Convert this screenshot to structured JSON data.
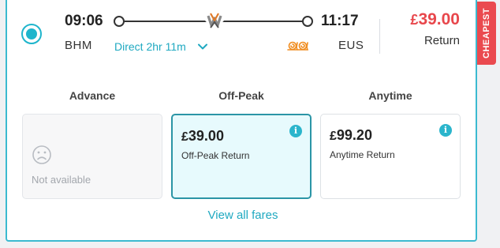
{
  "journey": {
    "departure_time": "09:06",
    "arrival_time": "11:17",
    "origin": "BHM",
    "destination": "EUS",
    "journey_type": "Direct 2hr 11m",
    "price_symbol": "£",
    "price_amount": "39.00",
    "ticket_type": "Return",
    "badge": "CHEAPEST",
    "operator_icon": "avanti-operator-logo",
    "selected": true
  },
  "fares": [
    {
      "header": "Advance",
      "available": false,
      "unavailable_text": "Not available"
    },
    {
      "header": "Off-Peak",
      "available": true,
      "price_symbol": "£",
      "price_amount": "39.00",
      "name": "Off-Peak Return",
      "selected": true
    },
    {
      "header": "Anytime",
      "available": true,
      "price_symbol": "£",
      "price_amount": "99.20",
      "name": "Anytime Return",
      "selected": false
    }
  ],
  "view_all_label": "View all fares",
  "colors": {
    "accent": "#1fb5cc",
    "price_red": "#e8474c",
    "badge_bg": "#ea4a4f",
    "selected_fare_bg": "#e7fafd",
    "snail_orange": "#f08c1e"
  }
}
